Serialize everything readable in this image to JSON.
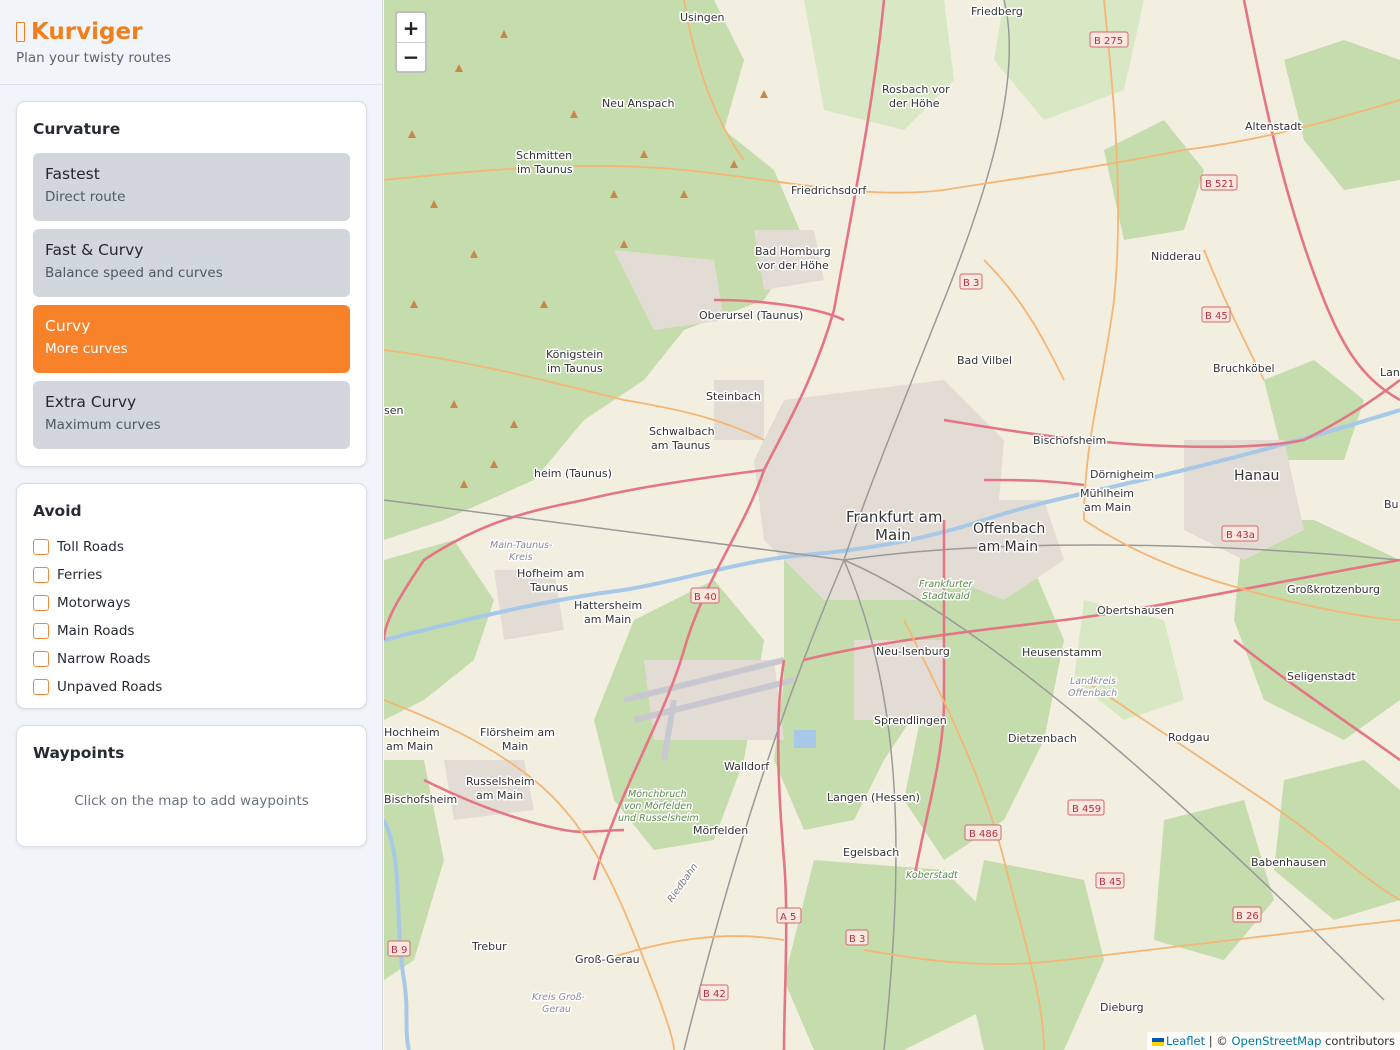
{
  "brand": {
    "title": "Kurviger",
    "subtitle": "Plan your twisty routes",
    "accent": "#f07f1e"
  },
  "curvature": {
    "title": "Curvature",
    "options": [
      {
        "title": "Fastest",
        "subtitle": "Direct route",
        "active": false
      },
      {
        "title": "Fast & Curvy",
        "subtitle": "Balance speed and curves",
        "active": false
      },
      {
        "title": "Curvy",
        "subtitle": "More curves",
        "active": true
      },
      {
        "title": "Extra Curvy",
        "subtitle": "Maximum curves",
        "active": false
      }
    ]
  },
  "avoid": {
    "title": "Avoid",
    "items": [
      {
        "label": "Toll Roads",
        "checked": false
      },
      {
        "label": "Ferries",
        "checked": false
      },
      {
        "label": "Motorways",
        "checked": false
      },
      {
        "label": "Main Roads",
        "checked": false
      },
      {
        "label": "Narrow Roads",
        "checked": false
      },
      {
        "label": "Unpaved Roads",
        "checked": false
      }
    ]
  },
  "waypoints": {
    "title": "Waypoints",
    "empty_text": "Click on the map to add waypoints"
  },
  "map": {
    "zoom_in": "+",
    "zoom_out": "−",
    "attribution": {
      "leaflet": "Leaflet",
      "sep": " | © ",
      "osm": "OpenStreetMap",
      "suffix": " contributors"
    },
    "places": {
      "usingen": "Usingen",
      "friedberg": "Friedberg",
      "rosbach1": "Rosbach vor",
      "rosbach2": "der Höhe",
      "neu_anspach": "Neu Anspach",
      "schmitten1": "Schmitten",
      "schmitten2": "im Taunus",
      "altenstadt": "Altenstadt",
      "friedrichsdorf": "Friedrichsdorf",
      "bad_homburg1": "Bad Homburg",
      "bad_homburg2": "vor der Höhe",
      "nidderau": "Nidderau",
      "oberursel": "Oberursel (Taunus)",
      "koenigstein1": "Königstein",
      "koenigstein2": "im Taunus",
      "bad_vilbel": "Bad Vilbel",
      "bruchkoebel": "Bruchköbel",
      "steinbach": "Steinbach",
      "schwalbach1": "Schwalbach",
      "schwalbach2": "am Taunus",
      "bischofsheim": "Bischofsheim",
      "doernigheim": "Dörnigheim",
      "muehlheim1": "Mühlheim",
      "muehlheim2": "am Main",
      "hanau": "Hanau",
      "eschborn": "heim (Taunus)",
      "frankfurt1": "Frankfurt am",
      "frankfurt2": "Main",
      "offenbach1": "Offenbach",
      "offenbach2": "am Main",
      "hofheim1": "Hofheim am",
      "hofheim2": "Taunus",
      "hattersheim1": "Hattersheim",
      "hattersheim2": "am Main",
      "main_taunus1": "Main-Taunus-",
      "main_taunus2": "Kreis",
      "frankfurter1": "Frankfurter",
      "frankfurter2": "Stadtwald",
      "obertshausen": "Obertshausen",
      "grosskrotzenburg": "Großkrotzenburg",
      "neu_isenburg": "Neu-Isenburg",
      "heusenstamm": "Heusenstamm",
      "seligenstadt": "Seligenstadt",
      "landkreis1": "Landkreis",
      "landkreis2": "Offenbach",
      "hochheim1": "Hochheim",
      "hochheim2": "am Main",
      "floersheim1": "Flörsheim am",
      "floersheim2": "Main",
      "sprendlingen": "Sprendlingen",
      "dietzenbach": "Dietzenbach",
      "rodgau": "Rodgau",
      "walldorf": "Walldorf",
      "ruesselsheim1": "Russelsheim",
      "ruesselsheim2": "am Main",
      "bischofsheim2": "Bischofsheim",
      "moenchbruch1": "Mönchbruch",
      "moenchbruch2": "von Mörfelden",
      "moenchbruch3": "und Russelsheim",
      "langen": "Langen (Hessen)",
      "moerfelden": "Mörfelden",
      "egelsbach": "Egelsbach",
      "babenhausen": "Babenhausen",
      "koberstadt": "Koberstadt",
      "trebur": "Trebur",
      "gross_gerau": "Groß-Gerau",
      "kreis_gg1": "Kreis Groß-",
      "kreis_gg2": "Gerau",
      "dieburg": "Dieburg",
      "riedbahn": "Riedbahn",
      "sen": "sen",
      "lan": "Lan",
      "bu": "Bu"
    },
    "road_badges": [
      "B 275",
      "B 521",
      "B 3",
      "B 45",
      "B 43a",
      "B 40",
      "B 459",
      "B 486",
      "B 45",
      "A 5",
      "B 3",
      "B 26",
      "B 42",
      "B 9"
    ]
  }
}
